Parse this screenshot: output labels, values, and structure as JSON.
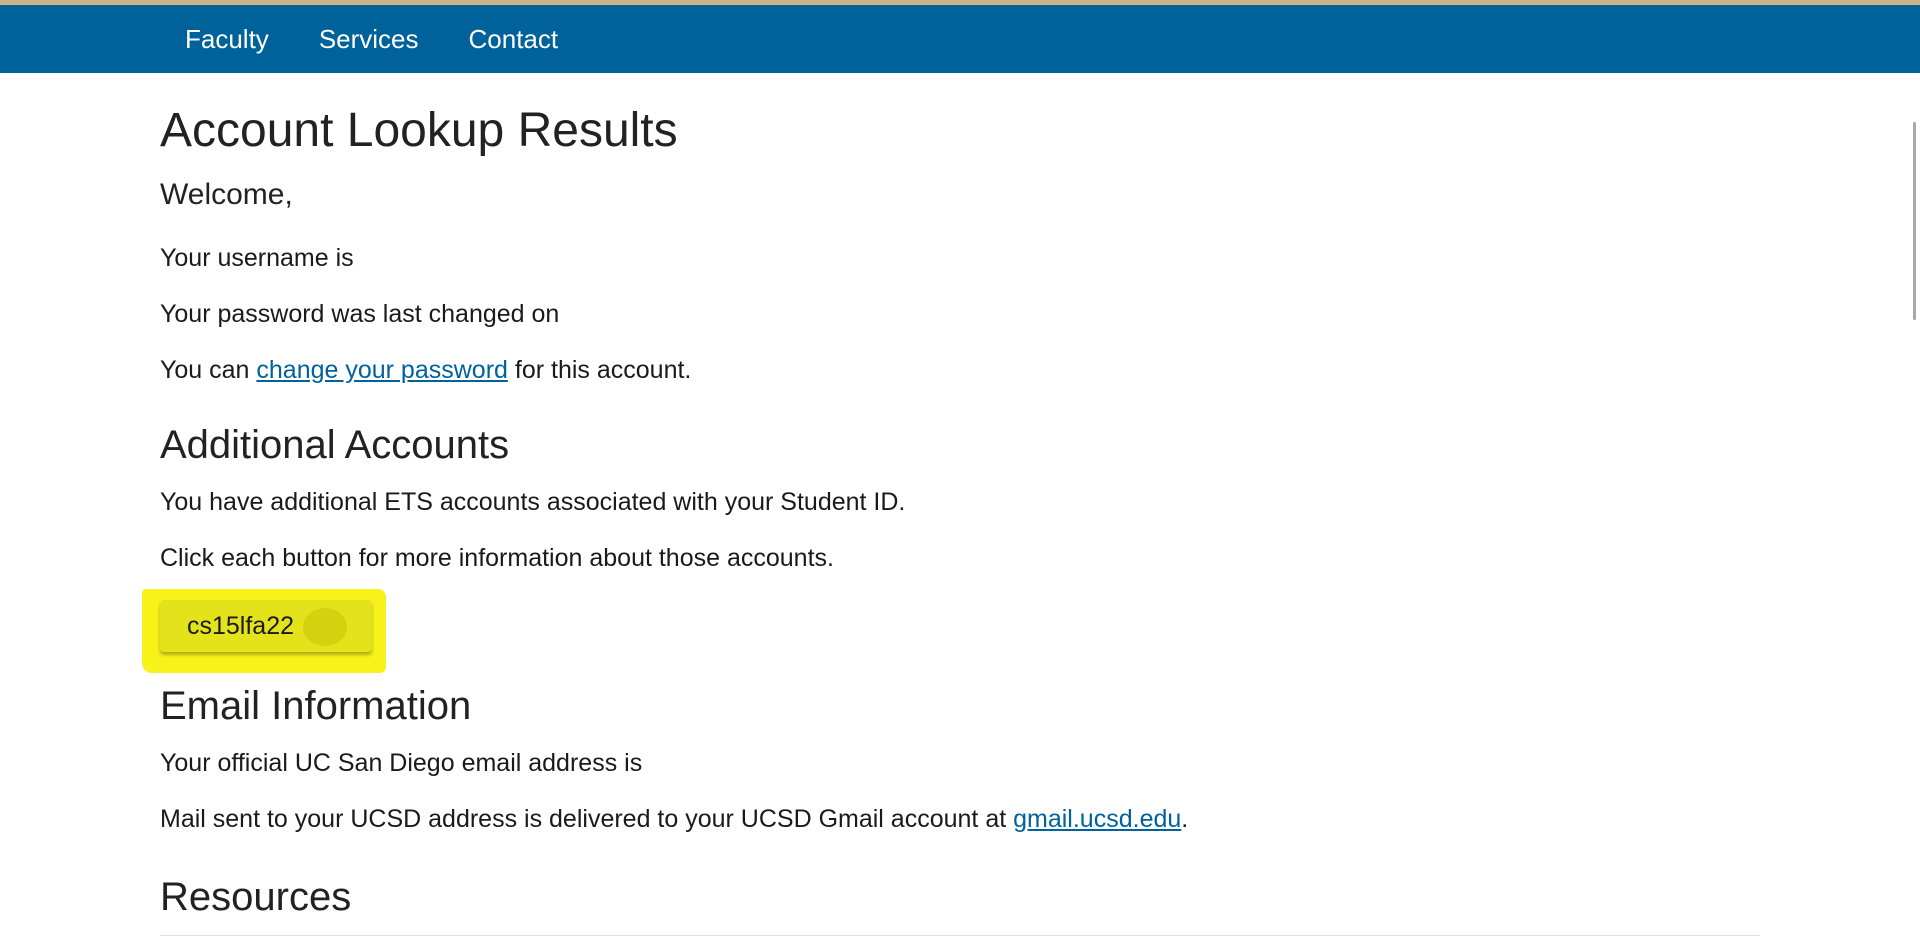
{
  "nav": {
    "items": [
      {
        "label": "Faculty"
      },
      {
        "label": "Services"
      },
      {
        "label": "Contact"
      }
    ]
  },
  "page": {
    "title": "Account Lookup Results",
    "welcome": "Welcome,",
    "username_text": "Your username is",
    "password_changed_text": "Your password was last changed on",
    "change_prefix": "You can ",
    "change_link": "change your password",
    "change_suffix": " for this account."
  },
  "additional_accounts": {
    "heading": "Additional Accounts",
    "line1": "You have additional ETS accounts associated with your Student ID.",
    "line2": "Click each button for more information about those accounts.",
    "button_label": "cs15lfa22"
  },
  "email": {
    "heading": "Email Information",
    "official_text": "Your official UC San Diego email address is",
    "mail_prefix": "Mail sent to your UCSD address is delivered to your UCSD Gmail account at ",
    "mail_link": "gmail.ucsd.edu",
    "mail_suffix": "."
  },
  "resources": {
    "heading": "Resources"
  },
  "colors": {
    "nav_background": "#00629b",
    "link": "#00629b",
    "highlight": "#f6f21a",
    "button": "#e4e21a"
  }
}
